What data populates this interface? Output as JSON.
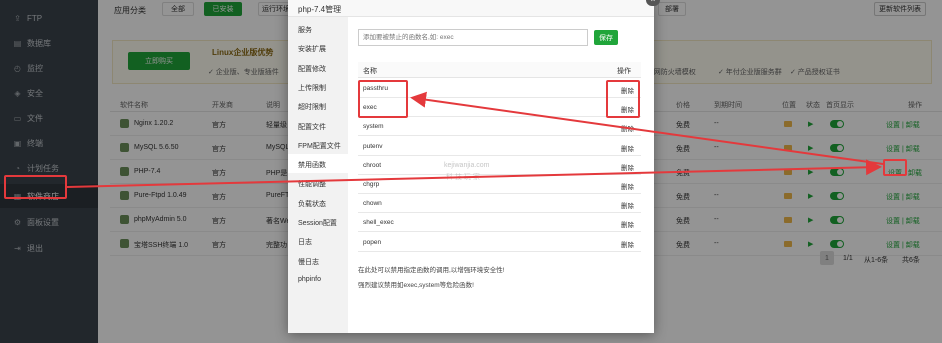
{
  "sidebar": {
    "items": [
      {
        "label": "FTP",
        "icon": "ftp-icon",
        "glyph": "⇪"
      },
      {
        "label": "数据库",
        "icon": "database-icon",
        "glyph": "▤"
      },
      {
        "label": "监控",
        "icon": "monitor-icon",
        "glyph": "◴"
      },
      {
        "label": "安全",
        "icon": "shield-icon",
        "glyph": "◈"
      },
      {
        "label": "文件",
        "icon": "folder-icon",
        "glyph": "▭"
      },
      {
        "label": "终端",
        "icon": "terminal-icon",
        "glyph": "▣"
      },
      {
        "label": "计划任务",
        "icon": "clock-icon",
        "glyph": "◔"
      },
      {
        "label": "软件商店",
        "icon": "apps-icon",
        "glyph": "▦"
      },
      {
        "label": "面板设置",
        "icon": "settings-icon",
        "glyph": "⚙"
      },
      {
        "label": "退出",
        "icon": "logout-icon",
        "glyph": "⇥"
      }
    ]
  },
  "header": {
    "category_label": "应用分类",
    "tabs": [
      "全部",
      "已安装",
      "运行环境"
    ],
    "tab_right": "部署",
    "update_list": "更新软件列表"
  },
  "promo": {
    "buy_button": "立即购买",
    "title": "Linux企业版优势",
    "features_left": "✓ 企业版、专业版插件",
    "features_right": [
      "✓ 网防火墙模权",
      "✓ 年付企业版服务群",
      "✓ 产品授权证书"
    ]
  },
  "table": {
    "headers": [
      "软件名称",
      "开发商",
      "说明",
      "价格",
      "到期时间",
      "位置",
      "状态",
      "首页显示",
      "操作"
    ],
    "rows": [
      {
        "name": "Nginx 1.20.2",
        "dev": "官方",
        "desc": "轻量级",
        "price": "免费",
        "expire": "--",
        "ops": "设置 | 卸载"
      },
      {
        "name": "MySQL 5.6.50",
        "dev": "官方",
        "desc": "MySQL",
        "price": "免费",
        "expire": "--",
        "ops": "设置 | 卸载"
      },
      {
        "name": "PHP-7.4",
        "dev": "官方",
        "desc": "PHP是",
        "price": "免费",
        "expire": "--",
        "ops_set": "设置",
        "ops_un": "卸载"
      },
      {
        "name": "Pure-Ftpd 1.0.49",
        "dev": "官方",
        "desc": "PureFT",
        "price": "免费",
        "expire": "--",
        "ops": "设置 | 卸载"
      },
      {
        "name": "phpMyAdmin 5.0",
        "dev": "官方",
        "desc": "著名We",
        "price": "免费",
        "expire": "--",
        "ops": "设置 | 卸载"
      },
      {
        "name": "宝塔SSH终端 1.0",
        "dev": "官方",
        "desc": "完整功",
        "price": "免费",
        "expire": "--",
        "ops": "设置 | 卸载"
      }
    ]
  },
  "pagination": {
    "page": "1",
    "pages": "1/1",
    "range": "从1-6条",
    "total": "共6条"
  },
  "modal": {
    "title": "php-7.4管理",
    "menu": [
      "服务",
      "安装扩展",
      "配置修改",
      "上传限制",
      "超时限制",
      "配置文件",
      "FPM配置文件",
      "禁用函数",
      "性能调整",
      "负载状态",
      "Session配置",
      "日志",
      "慢日志",
      "phpinfo"
    ],
    "input_placeholder": "添加要被禁止的函数名,如: exec",
    "save": "保存",
    "col_name": "名称",
    "col_op": "操作",
    "functions": [
      "passthru",
      "exec",
      "system",
      "putenv",
      "chroot",
      "chgrp",
      "chown",
      "shell_exec",
      "popen"
    ],
    "delete": "删除",
    "notes": [
      "在此处可以禁用指定函数的调用,以增强环境安全性!",
      "强烈建议禁用如exec,system等危险函数!"
    ],
    "watermark1": "kejiwanjia.com",
    "watermark2": "科 技 玩 家"
  }
}
